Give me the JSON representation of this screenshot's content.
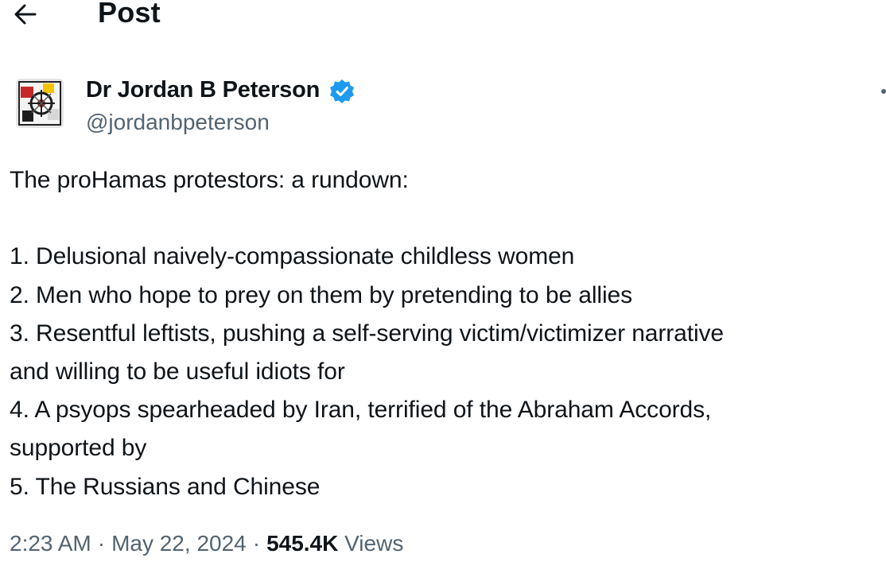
{
  "header": {
    "title": "Post",
    "back_icon": "arrow-left-icon"
  },
  "author": {
    "display_name": "Dr Jordan B Peterson",
    "handle": "@jordanbpeterson",
    "verified_icon": "verified-badge-icon",
    "verified_color": "#1d9bf0"
  },
  "post": {
    "lines": [
      "The proHamas protestors: a rundown:",
      "",
      "1. Delusional naively-compassionate childless women",
      "2. Men who hope to prey on them by pretending to be allies",
      "3. Resentful leftists, pushing a self-serving victim/victimizer narrative",
      "and willing to be useful idiots for",
      "4. A psyops spearheaded by Iran, terrified of the Abraham Accords,",
      "supported by",
      "5. The Russians and Chinese"
    ]
  },
  "meta": {
    "time": "2:23 AM",
    "separator": "·",
    "date": "May 22, 2024",
    "views_count": "545.4K",
    "views_label": "Views"
  },
  "colors": {
    "text_primary": "#0f1419",
    "text_secondary": "#536471",
    "background": "#ffffff"
  }
}
